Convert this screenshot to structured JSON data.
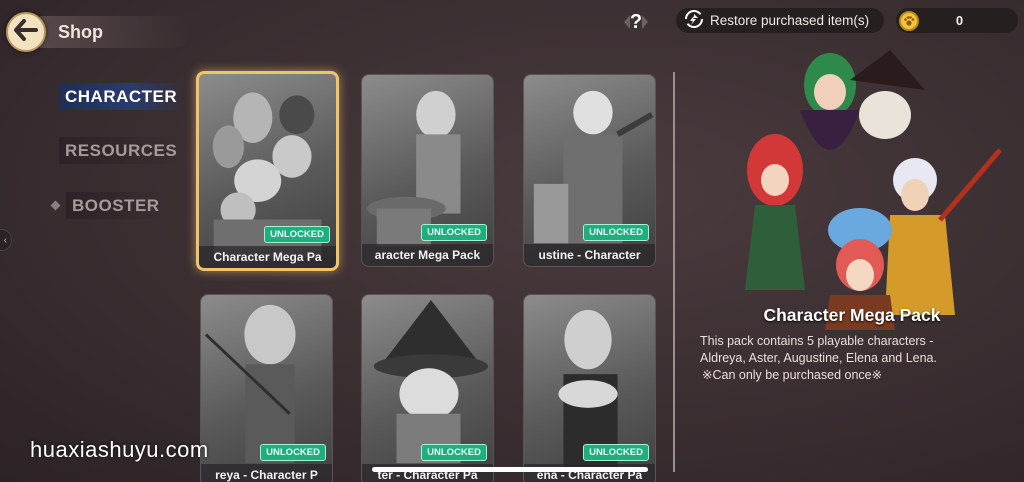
{
  "header": {
    "back_icon": "arrow-left-icon",
    "title": "Shop",
    "help_label": "?",
    "restore_label": "Restore purchased item(s)",
    "restore_icon": "refresh-icon",
    "coin_icon": "paw-coin-icon",
    "coin_value": "0"
  },
  "sidebar": {
    "items": [
      {
        "label": "CHARACTER",
        "active": true
      },
      {
        "label": "RESOURCES",
        "active": false
      },
      {
        "label": "BOOSTER",
        "active": false
      }
    ]
  },
  "cards": [
    {
      "name": "Character Mega Pa",
      "badge": "UNLOCKED",
      "selected": true
    },
    {
      "name": "aracter Mega Pack",
      "badge": "UNLOCKED",
      "selected": false
    },
    {
      "name": "ustine - Character",
      "badge": "UNLOCKED",
      "selected": false
    },
    {
      "name": "reya - Character P",
      "badge": "UNLOCKED",
      "selected": false
    },
    {
      "name": "ter - Character Pa",
      "badge": "UNLOCKED",
      "selected": false
    },
    {
      "name": "ena - Character Pa",
      "badge": "UNLOCKED",
      "selected": false
    }
  ],
  "detail": {
    "title": "Character Mega Pack",
    "description_lines": [
      "This pack contains 5 playable characters -",
      "Aldreya, Aster, Augustine, Elena and Lena.",
      "※Can only be purchased once※"
    ]
  },
  "watermark": "huaxiashuyu.com",
  "colors": {
    "accent_gold": "#f0c467",
    "unlocked_green": "#1fae7e",
    "active_tab_blue": "#1f2d57",
    "background": "#3a2e31"
  }
}
